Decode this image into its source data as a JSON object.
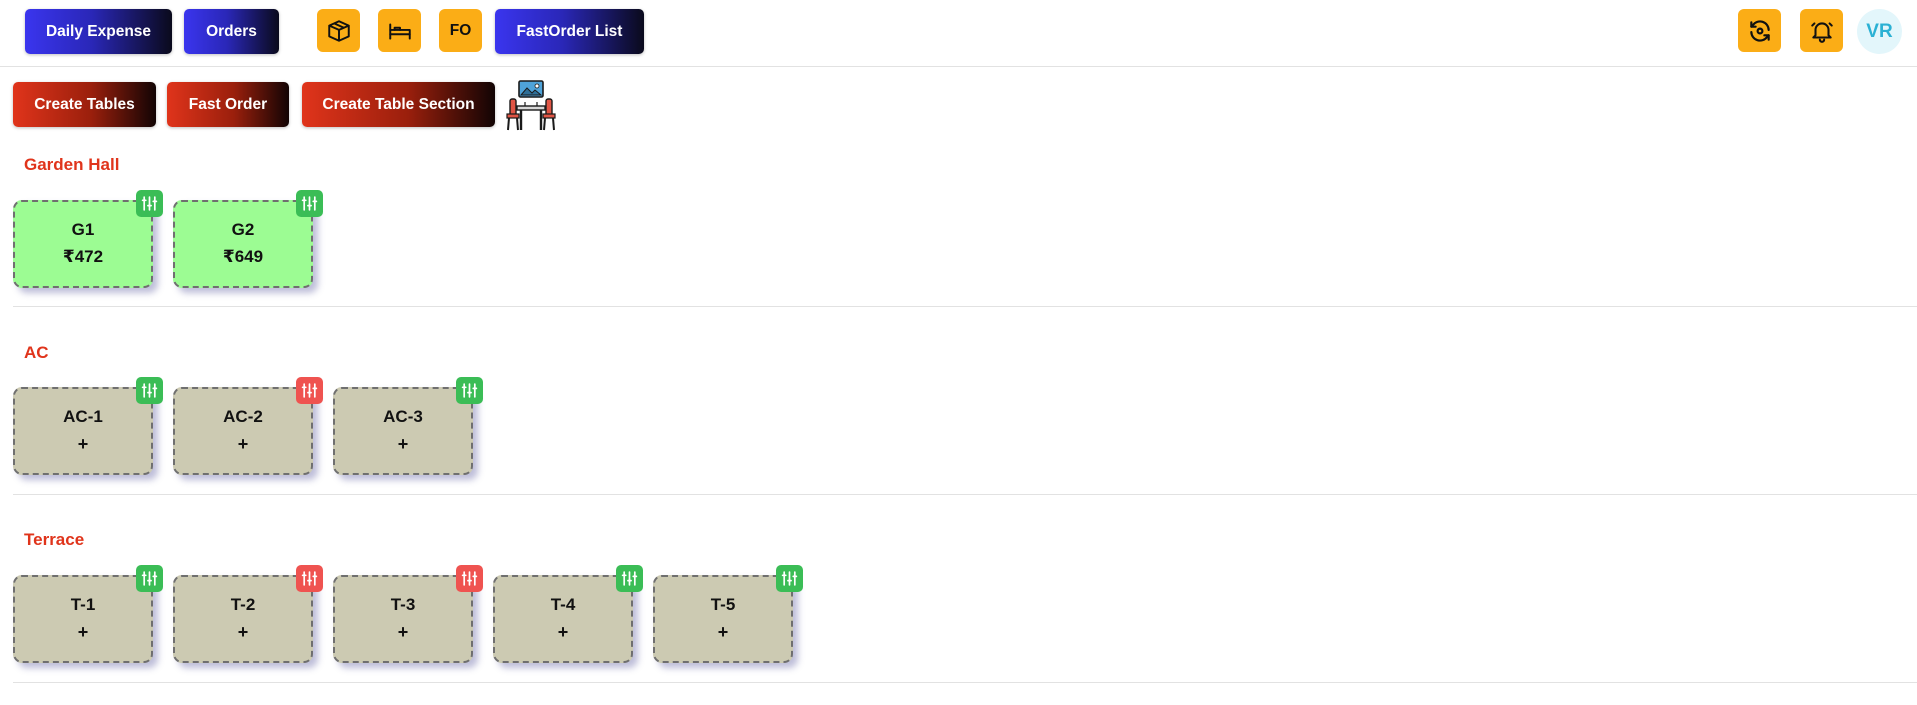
{
  "topbar": {
    "daily_expense_label": "Daily Expense",
    "orders_label": "Orders",
    "fo_label": "FO",
    "fastorder_list_label": "FastOrder List",
    "avatar_initials": "VR",
    "icons": [
      "box-icon",
      "bed-icon",
      "refresh-icon",
      "bell-icon"
    ]
  },
  "actions": {
    "create_tables_label": "Create Tables",
    "fast_order_label": "Fast Order",
    "create_section_label": "Create Table Section"
  },
  "sections": [
    {
      "title": "Garden Hall",
      "tables": [
        {
          "name": "G1",
          "amount": "₹472",
          "status": "occupied",
          "flag": "green"
        },
        {
          "name": "G2",
          "amount": "₹649",
          "status": "occupied",
          "flag": "green"
        }
      ]
    },
    {
      "title": "AC",
      "tables": [
        {
          "name": "AC-1",
          "amount": "+",
          "status": "free",
          "flag": "green"
        },
        {
          "name": "AC-2",
          "amount": "+",
          "status": "free",
          "flag": "red"
        },
        {
          "name": "AC-3",
          "amount": "+",
          "status": "free",
          "flag": "green"
        }
      ]
    },
    {
      "title": "Terrace",
      "tables": [
        {
          "name": "T-1",
          "amount": "+",
          "status": "free",
          "flag": "green"
        },
        {
          "name": "T-2",
          "amount": "+",
          "status": "free",
          "flag": "red"
        },
        {
          "name": "T-3",
          "amount": "+",
          "status": "free",
          "flag": "red"
        },
        {
          "name": "T-4",
          "amount": "+",
          "status": "free",
          "flag": "green"
        },
        {
          "name": "T-5",
          "amount": "+",
          "status": "free",
          "flag": "green"
        }
      ]
    }
  ],
  "colors": {
    "occupied": "#9cfc93",
    "free": "#cccab2",
    "flag_green": "#3bbd56",
    "flag_red": "#ef5350",
    "section_title": "#e0341b",
    "accent_yellow": "#fbad16"
  }
}
